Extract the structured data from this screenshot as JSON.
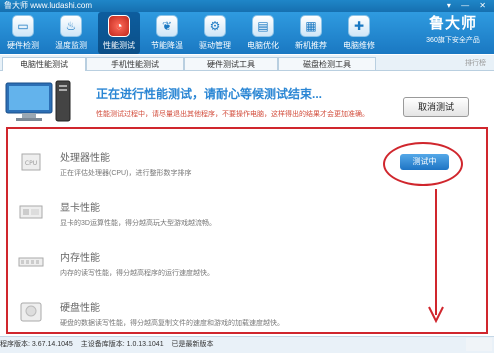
{
  "window": {
    "app_title": "鲁大师 www.ludashi.com",
    "controls": "▾ — ✕"
  },
  "nav": {
    "items": [
      {
        "label": "硬件检测",
        "icon": "monitor-icon"
      },
      {
        "label": "温度监测",
        "icon": "thermometer-icon"
      },
      {
        "label": "性能测试",
        "icon": "speedometer-icon"
      },
      {
        "label": "节能降温",
        "icon": "leaf-icon"
      },
      {
        "label": "驱动管理",
        "icon": "gear-icon"
      },
      {
        "label": "电脑优化",
        "icon": "chart-icon"
      },
      {
        "label": "新机推荐",
        "icon": "laptop-icon"
      },
      {
        "label": "电脑维修",
        "icon": "wrench-icon"
      }
    ],
    "active_index": 2
  },
  "logo": {
    "name": "鲁大师",
    "subtitle": "360旗下安全产品"
  },
  "tabs": {
    "items": [
      "电脑性能测试",
      "手机性能测试",
      "硬件测试工具",
      "磁盘检测工具"
    ],
    "extra": "排行榜"
  },
  "banner": {
    "status": "正在进行性能测试，请耐心等候测试结束...",
    "hint": "性能测试过程中，请尽量退出其他程序，不要操作电脑，这样得出的结果才会更加准确。",
    "cancel_button": "取消测试"
  },
  "tests": [
    {
      "title": "处理器性能",
      "desc": "正在评估处理器(CPU)，进行整形数字排序",
      "icon": "cpu-icon"
    },
    {
      "title": "显卡性能",
      "desc": "显卡的3D运算性能，得分越高玩大型游戏越流畅。",
      "icon": "graphics-card-icon"
    },
    {
      "title": "内存性能",
      "desc": "内存的读写性能，得分越高程序的运行速度越快。",
      "icon": "memory-icon"
    },
    {
      "title": "硬盘性能",
      "desc": "硬盘的数据读写性能，得分越高复制文件的速度和游戏的加载速度越快。",
      "icon": "hard-disk-icon"
    }
  ],
  "testing_button": "测试中",
  "statusbar": {
    "program_version": "程序版本: 3.67.14.1045",
    "device_lib": "主设备库版本: 1.0.13.1041",
    "latest": "已是最新版本"
  }
}
